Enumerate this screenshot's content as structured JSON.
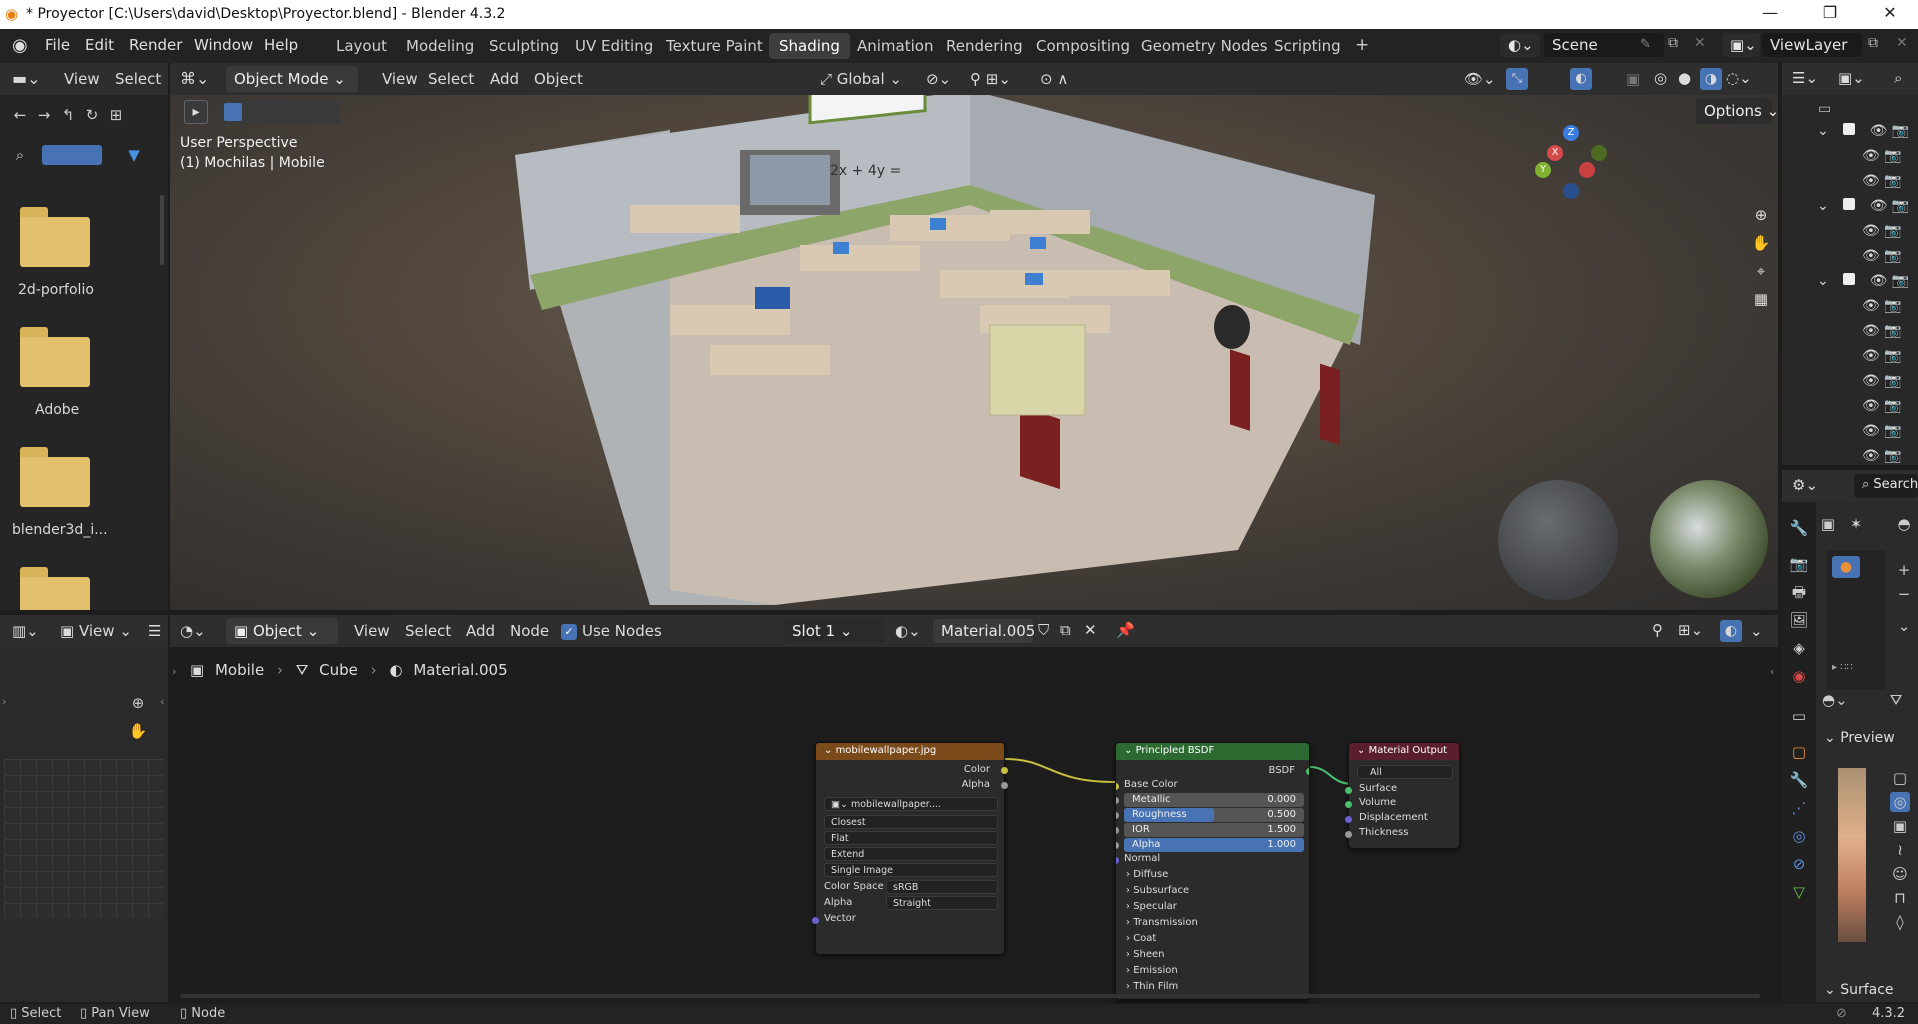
{
  "title_bar": {
    "title": "* Proyector [C:\\Users\\david\\Desktop\\Proyector.blend] - Blender 4.3.2",
    "minimize": "—",
    "maximize": "❐",
    "close": "✕"
  },
  "menu": [
    "File",
    "Edit",
    "Render",
    "Window",
    "Help"
  ],
  "workspaces": [
    "Layout",
    "Modeling",
    "Sculpting",
    "UV Editing",
    "Texture Paint",
    "Shading",
    "Animation",
    "Rendering",
    "Compositing",
    "Geometry Nodes",
    "Scripting",
    "+"
  ],
  "active_workspace": "Shading",
  "scene": {
    "name": "Scene",
    "view_layer": "ViewLayer"
  },
  "file_browser": {
    "header_view": "View",
    "header_select": "Select",
    "folders": [
      "2d-porfolio",
      "Adobe",
      "blender3d_i...",
      ""
    ]
  },
  "viewport": {
    "mode": "Object Mode",
    "menus": [
      "View",
      "Select",
      "Add",
      "Object"
    ],
    "orientation": "Global",
    "options": "Options",
    "info_line1": "User Perspective",
    "info_line2": "(1) Mochilas | Mobile",
    "whiteboard": "2x + 4y ="
  },
  "node_editor": {
    "editor": "Object",
    "menus": [
      "View",
      "Select",
      "Add",
      "Node"
    ],
    "use_nodes": "Use Nodes",
    "slot": "Slot 1",
    "material": "Material.005",
    "breadcrumb": [
      "Mobile",
      "Cube",
      "Material.005"
    ],
    "image_node": {
      "title": "mobilewallpaper.jpg",
      "out_color": "Color",
      "out_alpha": "Alpha",
      "image": "mobilewallpaper....",
      "interp": "Closest",
      "projection": "Flat",
      "extension": "Extend",
      "source": "Single Image",
      "cs_label": "Color Space",
      "cs_value": "sRGB",
      "alpha_label": "Alpha",
      "alpha_value": "Straight",
      "vector": "Vector"
    },
    "bsdf_node": {
      "title": "Principled BSDF",
      "out": "BSDF",
      "base_color": "Base Color",
      "metallic_label": "Metallic",
      "metallic": "0.000",
      "metallic_frac": 0.0,
      "roughness_label": "Roughness",
      "roughness": "0.500",
      "roughness_frac": 0.5,
      "ior_label": "IOR",
      "ior": "1.500",
      "alpha_label": "Alpha",
      "alpha": "1.000",
      "alpha_frac": 1.0,
      "normal": "Normal",
      "panels": [
        "Diffuse",
        "Subsurface",
        "Specular",
        "Transmission",
        "Coat",
        "Sheen",
        "Emission",
        "Thin Film"
      ]
    },
    "output_node": {
      "title": "Material Output",
      "target": "All",
      "inputs": [
        "Surface",
        "Volume",
        "Displacement",
        "Thickness"
      ]
    }
  },
  "image_editor": {
    "view": "View"
  },
  "properties": {
    "search": "Search",
    "preview": "Preview",
    "surface": "Surface"
  },
  "status_bar": {
    "select": "Select",
    "pan": "Pan View",
    "node": "Node",
    "version": "4.3.2"
  },
  "colors": {
    "image_node_header": "#7a4a1b",
    "bsdf_header": "#2c6a31",
    "output_header": "#5a1f2c",
    "active_field": "#4772b3",
    "accent": "#4a7fd0"
  }
}
